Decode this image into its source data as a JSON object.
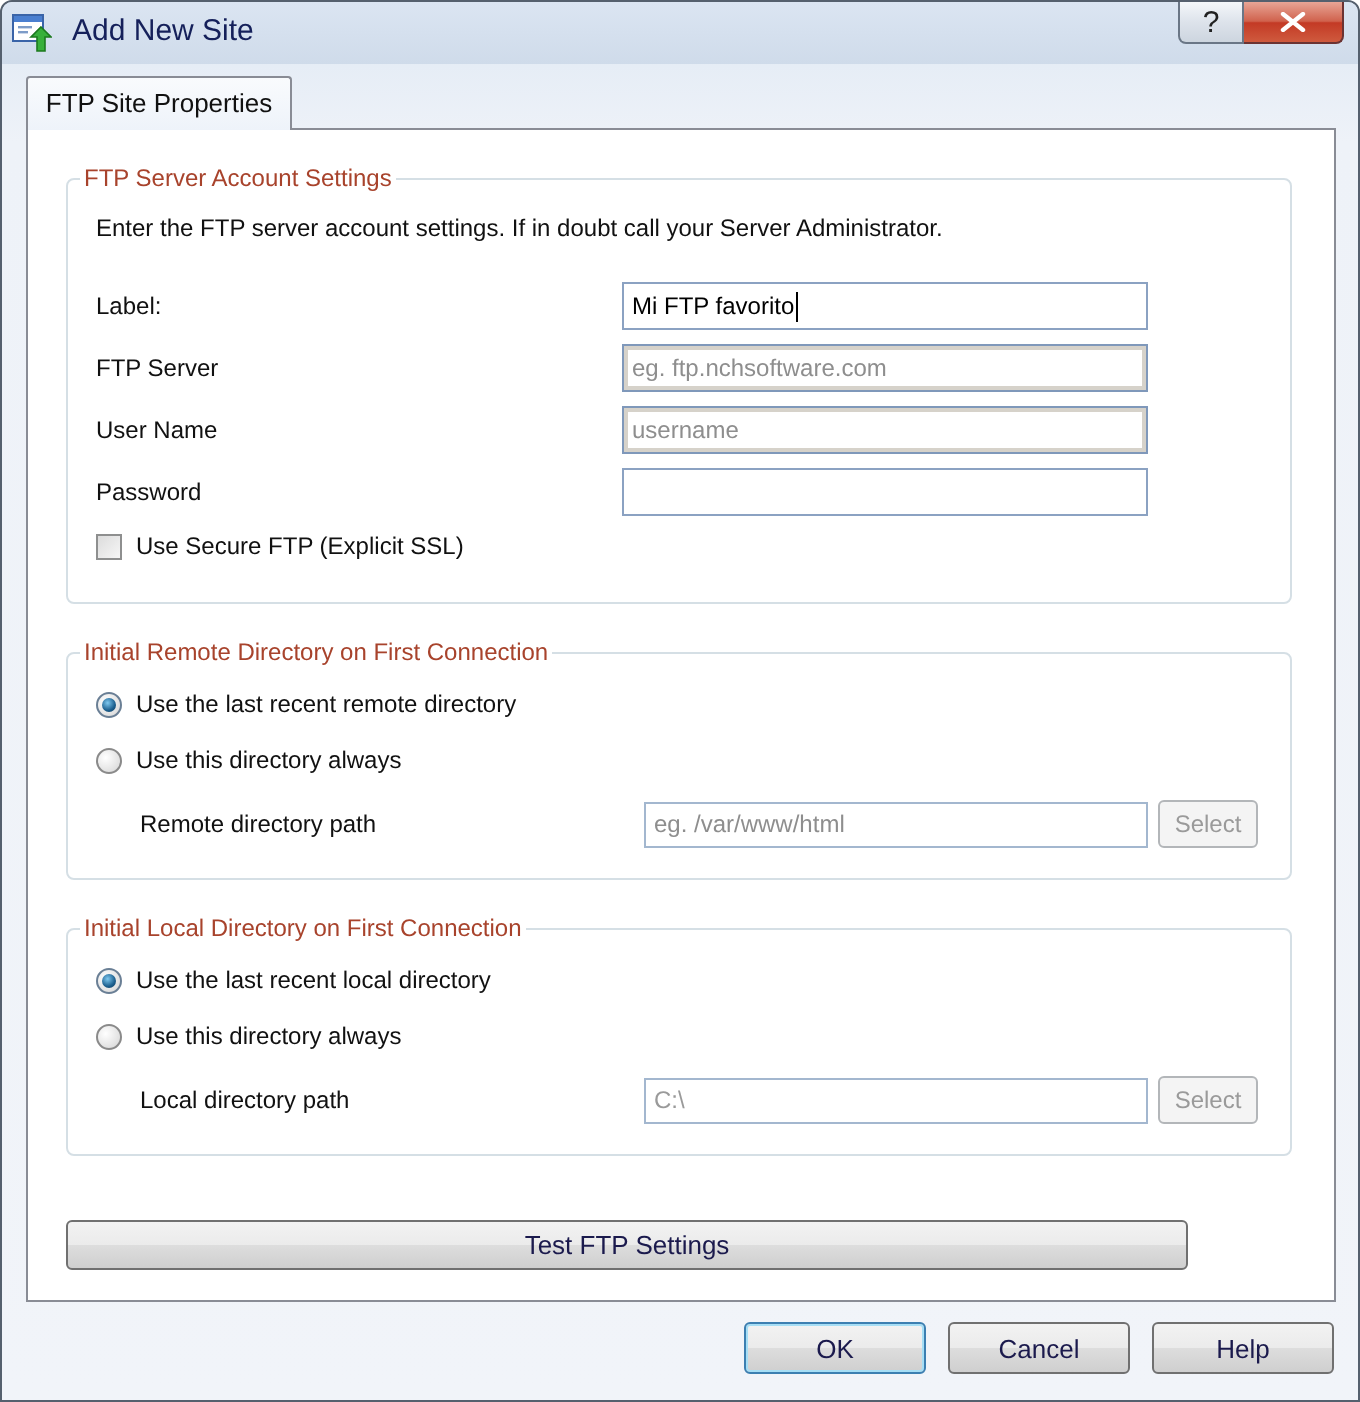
{
  "window": {
    "title": "Add New Site",
    "help_button": "?"
  },
  "tabs": [
    {
      "label": "FTP Site Properties",
      "selected": true
    }
  ],
  "groups": [
    {
      "kind": "account",
      "title": "FTP Server Account Settings",
      "intro": "Enter the FTP server account settings. If in doubt call your Server Administrator.",
      "fields": [
        {
          "label": "Label:",
          "kind": "plain",
          "value": "Mi FTP favorito",
          "focused": true
        },
        {
          "label": "FTP Server",
          "kind": "inset",
          "placeholder": "eg. ftp.nchsoftware.com",
          "focused": false
        },
        {
          "label": "User Name",
          "kind": "inset",
          "placeholder": "username",
          "focused": false
        },
        {
          "label": "Password",
          "kind": "plain",
          "focused": false
        }
      ],
      "checkbox": {
        "label": "Use Secure FTP (Explicit SSL)",
        "checked": false
      }
    },
    {
      "kind": "directory",
      "title": "Initial Remote Directory on First Connection",
      "options": [
        {
          "label": "Use the last recent remote directory",
          "selected": true
        },
        {
          "label": "Use this directory always",
          "selected": false
        }
      ],
      "path": {
        "label": "Remote directory path",
        "placeholder": "eg. /var/www/html",
        "disabled": true
      },
      "button": {
        "label": "Select",
        "disabled": true
      }
    },
    {
      "kind": "directory",
      "title": "Initial Local Directory on First Connection",
      "options": [
        {
          "label": "Use the last recent local directory",
          "selected": true
        },
        {
          "label": "Use this directory always",
          "selected": false
        }
      ],
      "path": {
        "label": "Local directory path",
        "value": "C:\\",
        "disabled": true
      },
      "button": {
        "label": "Select",
        "disabled": true
      }
    }
  ],
  "test_button": "Test FTP Settings",
  "buttons": [
    {
      "label": "OK",
      "default": true
    },
    {
      "label": "Cancel",
      "default": false
    },
    {
      "label": "Help",
      "default": false
    }
  ]
}
